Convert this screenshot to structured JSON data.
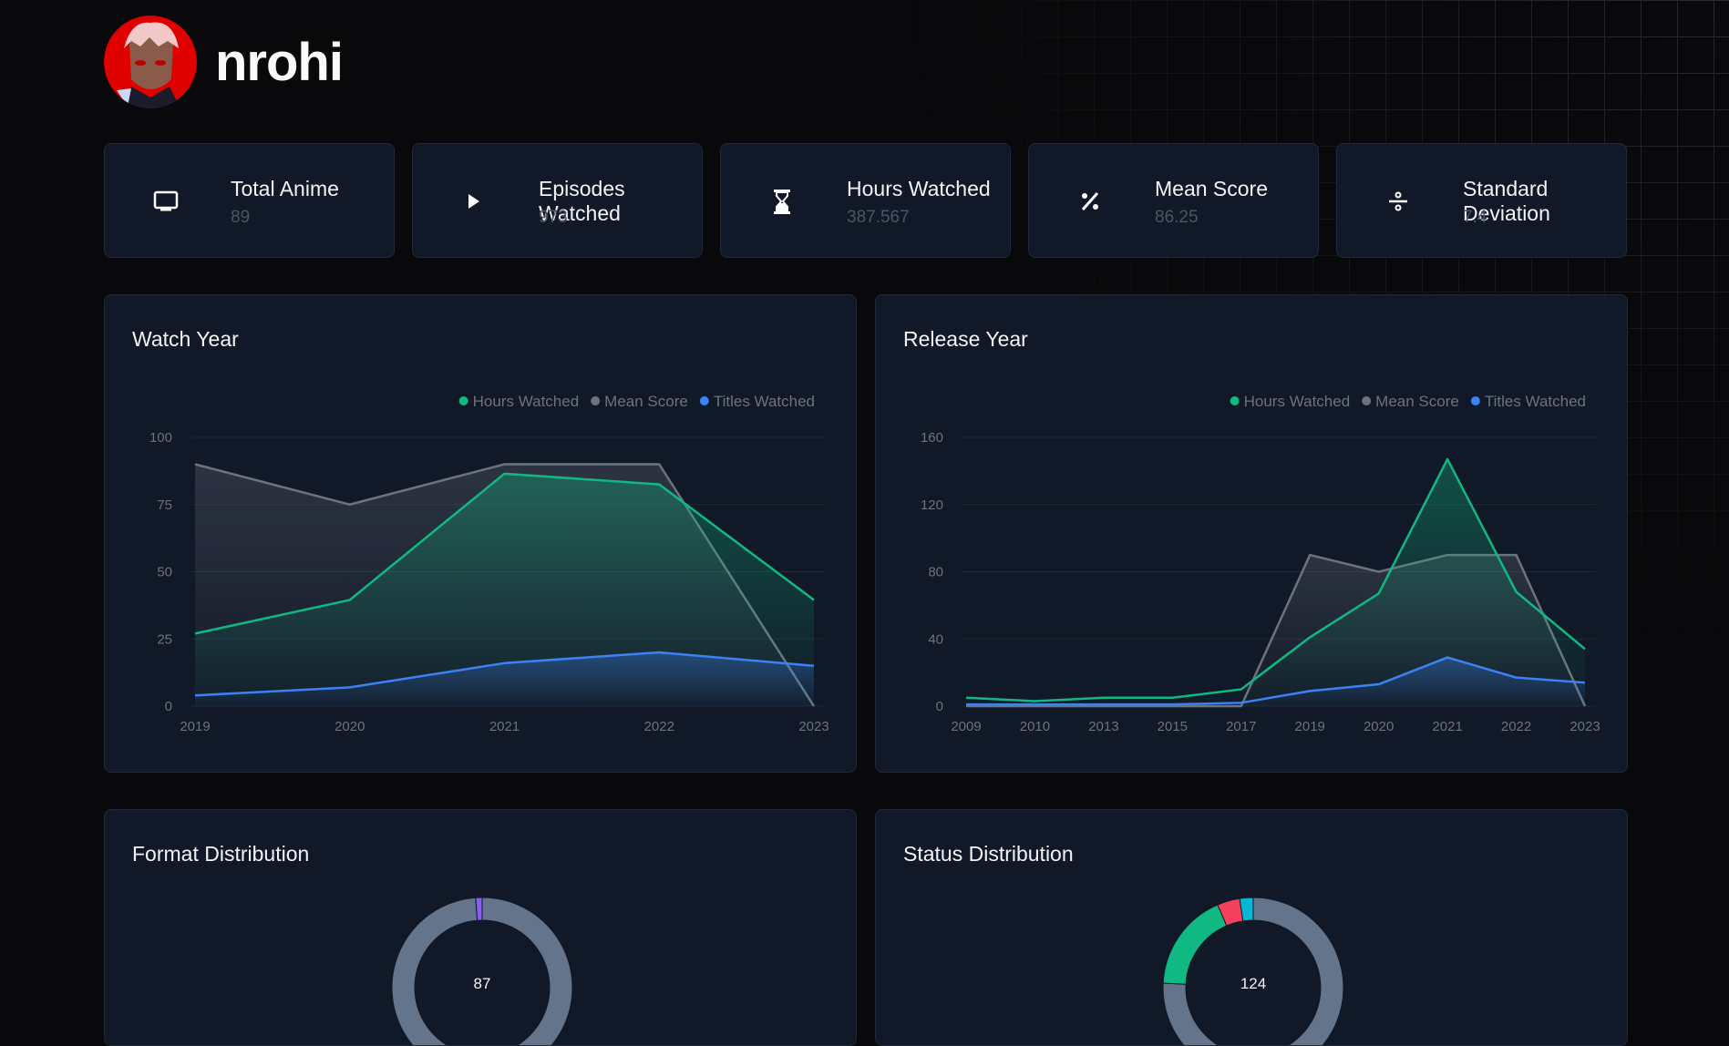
{
  "user": {
    "name": "nrohi"
  },
  "stats": [
    {
      "label": "Total Anime",
      "value": "89",
      "icon": "monitor-icon"
    },
    {
      "label": "Episodes Watched",
      "value": "973",
      "icon": "play-icon"
    },
    {
      "label": "Hours Watched",
      "value": "387.567",
      "icon": "hourglass-icon"
    },
    {
      "label": "Mean Score",
      "value": "86.25",
      "icon": "percent-icon"
    },
    {
      "label": "Standard Deviation",
      "value": "7.4",
      "icon": "divide-icon"
    }
  ],
  "colors": {
    "hours": "#10b981",
    "mean": "#6b7280",
    "titles": "#3b82f6",
    "purple": "#8b5cf6",
    "red": "#f43f5e",
    "cyan": "#06b6d4",
    "slate": "#64748b"
  },
  "chart_data": [
    {
      "type": "area",
      "title": "Watch Year",
      "legend_position": "top-right",
      "grid": true,
      "categories": [
        "2019",
        "2020",
        "2021",
        "2022",
        "2023"
      ],
      "ylim": [
        0,
        100
      ],
      "yticks": [
        0,
        25,
        50,
        75,
        100
      ],
      "series": [
        {
          "name": "Hours Watched",
          "values": [
            27,
            39.5,
            86.5,
            82.5,
            39.5
          ]
        },
        {
          "name": "Mean Score",
          "values": [
            90,
            75,
            90,
            90,
            0
          ]
        },
        {
          "name": "Titles Watched",
          "values": [
            4,
            7,
            16,
            20,
            15
          ]
        }
      ]
    },
    {
      "type": "area",
      "title": "Release Year",
      "legend_position": "top-right",
      "grid": true,
      "categories": [
        "2009",
        "2010",
        "2013",
        "2015",
        "2017",
        "2019",
        "2020",
        "2021",
        "2022",
        "2023"
      ],
      "ylim": [
        0,
        160
      ],
      "yticks": [
        0,
        40,
        80,
        120,
        160
      ],
      "series": [
        {
          "name": "Hours Watched",
          "values": [
            5,
            3,
            5,
            5,
            10,
            41,
            67,
            147,
            68,
            34
          ]
        },
        {
          "name": "Mean Score",
          "values": [
            0,
            0,
            0,
            0,
            0,
            90,
            80,
            90,
            90,
            0
          ]
        },
        {
          "name": "Titles Watched",
          "values": [
            1,
            1,
            1,
            1,
            2,
            9,
            13,
            29,
            17,
            14
          ]
        }
      ]
    },
    {
      "type": "pie",
      "title": "Format Distribution",
      "total": "87",
      "values": [
        86,
        1
      ],
      "slice_colors": [
        "#64748b",
        "#8b5cf6"
      ]
    },
    {
      "type": "pie",
      "title": "Status Distribution",
      "total": "124",
      "values": [
        94,
        22,
        5,
        3
      ],
      "slice_colors": [
        "#64748b",
        "#10b981",
        "#f43f5e",
        "#06b6d4"
      ]
    }
  ]
}
